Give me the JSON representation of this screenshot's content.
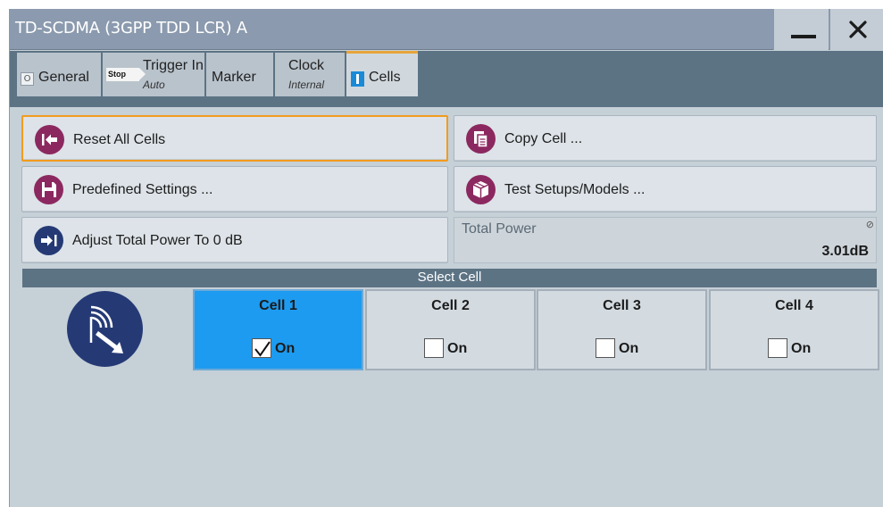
{
  "window": {
    "title": "TD-SCDMA (3GPP TDD LCR) A",
    "minimize_icon": "minimize-icon",
    "close_icon": "close-icon"
  },
  "tabs": [
    {
      "label": "General",
      "icon": "general-icon",
      "icon_text": "O"
    },
    {
      "label": "Trigger In",
      "sub": "Auto",
      "icon": "stop-icon",
      "icon_text": "Stop"
    },
    {
      "label": "Marker"
    },
    {
      "label": "Clock",
      "sub": "Internal"
    },
    {
      "label": "Cells",
      "icon": "cells-icon",
      "active": true
    }
  ],
  "buttons": {
    "reset_all_cells": "Reset All Cells",
    "copy_cell": "Copy Cell ...",
    "predefined_settings": "Predefined Settings ...",
    "test_setups": "Test Setups/Models ...",
    "adjust_total_power": "Adjust Total Power To 0 dB"
  },
  "total_power": {
    "label": "Total Power",
    "value": "3.01dB",
    "icon": "⊘"
  },
  "select_cell": {
    "header": "Select Cell",
    "on_label": "On",
    "cells": [
      {
        "name": "Cell 1",
        "selected": true,
        "on": true
      },
      {
        "name": "Cell 2",
        "selected": false,
        "on": false
      },
      {
        "name": "Cell 3",
        "selected": false,
        "on": false
      },
      {
        "name": "Cell 4",
        "selected": false,
        "on": false
      }
    ]
  },
  "colors": {
    "accent": "#1d9bf0",
    "focus": "#f29b1d",
    "icon_purple": "#8c2860",
    "icon_navy": "#253a75",
    "tabbar": "#5c7384"
  }
}
